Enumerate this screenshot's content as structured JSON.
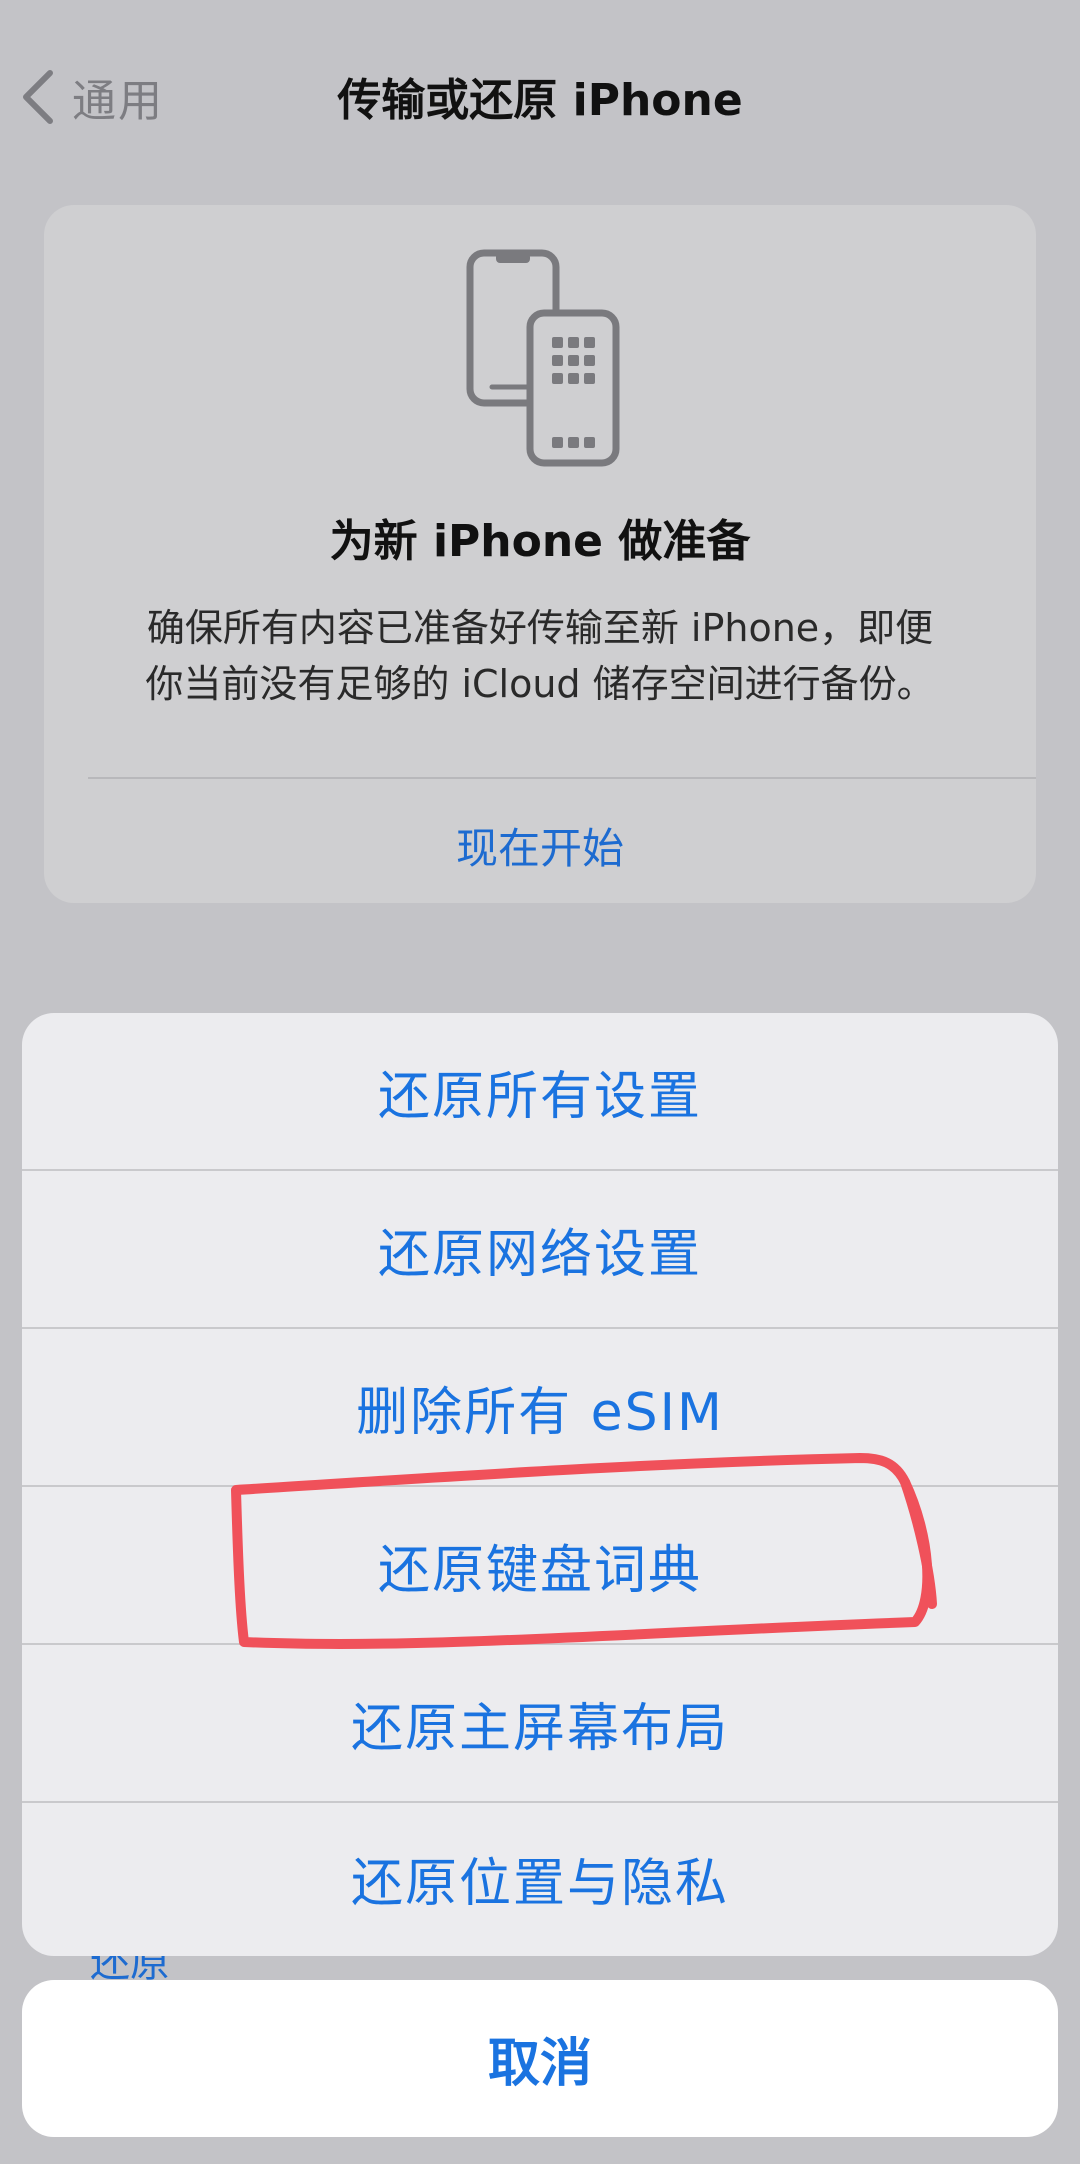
{
  "nav": {
    "back_label": "通用",
    "title": "传输或还原 iPhone"
  },
  "card": {
    "icon": "transfer-phones-icon",
    "title": "为新 iPhone 做准备",
    "description_line1": "确保所有内容已准备好传输至新 iPhone，即便",
    "description_line2": "你当前没有足够的 iCloud 储存空间进行备份。",
    "link": "现在开始"
  },
  "behind_sheet_text": "还原",
  "action_sheet": {
    "items": [
      {
        "label": "还原所有设置"
      },
      {
        "label": "还原网络设置"
      },
      {
        "label": "删除所有 eSIM"
      },
      {
        "label": "还原键盘词典"
      },
      {
        "label": "还原主屏幕布局"
      },
      {
        "label": "还原位置与隐私"
      }
    ],
    "cancel": "取消"
  },
  "colors": {
    "accent": "#1a73e0",
    "annotation": "#f0515a",
    "dimmed_background": "#c3c3c7"
  }
}
